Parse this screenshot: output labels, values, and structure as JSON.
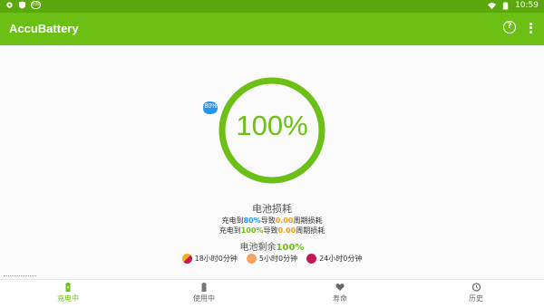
{
  "status_bar": {
    "time": "10:59",
    "left_icons": [
      "gear-icon",
      "shield-icon",
      "app-badge-icon"
    ],
    "app_badge_text": "100",
    "right_icons": [
      "wifi-icon",
      "battery-icon"
    ]
  },
  "app_bar": {
    "title": "AccuBattery",
    "help_icon": "help-icon",
    "more_icon": "more-vertical-icon"
  },
  "gauge": {
    "percent_text": "100%",
    "level": 1.0,
    "badge_text": "80%",
    "ring_color": "#6cbf14",
    "badge_color": "#2196f3"
  },
  "wear": {
    "title": "电池损耗",
    "line1": {
      "prefix": "充电到",
      "target": "80%",
      "mid": "导致",
      "cycles": "0.00",
      "suffix": "周期损耗"
    },
    "line2": {
      "prefix": "充电到",
      "target": "100%",
      "mid": "导致",
      "cycles": "0.00",
      "suffix": "周期损耗"
    }
  },
  "remaining": {
    "label": "电池剩余",
    "value": "100%"
  },
  "times": [
    {
      "icon": "screen-on-icon",
      "text": "18小时0分钟",
      "color": "#e57373"
    },
    {
      "icon": "screen-off-icon",
      "text": "5小时0分钟",
      "color": "#f4a261"
    },
    {
      "icon": "sleep-icon",
      "text": "24小时0分钟",
      "color": "#c2185b"
    }
  ],
  "nav": [
    {
      "label": "充电中",
      "icon": "charging-icon",
      "active": true
    },
    {
      "label": "使用中",
      "icon": "battery-discharge-icon",
      "active": false
    },
    {
      "label": "寿命",
      "icon": "heart-icon",
      "active": false
    },
    {
      "label": "历史",
      "icon": "history-icon",
      "active": false
    }
  ],
  "colors": {
    "primary": "#6cbf14",
    "status_bar": "#5ba80e",
    "blue": "#2196f3",
    "orange": "#f39c12"
  }
}
